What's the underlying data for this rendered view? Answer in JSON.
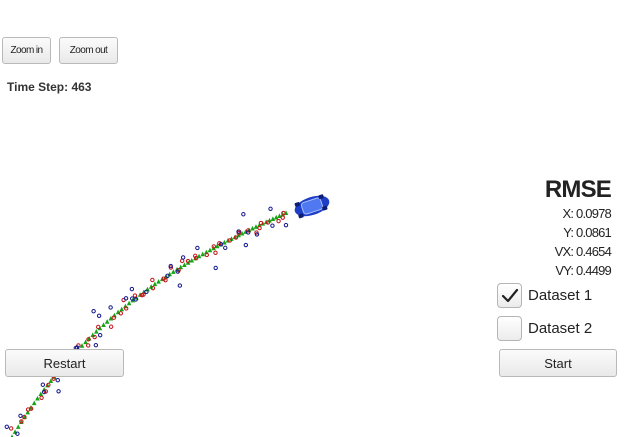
{
  "toolbar": {
    "zoom_in_label": "Zoom in",
    "zoom_out_label": "Zoom out"
  },
  "status": {
    "time_step_label": "Time Step: 463"
  },
  "rmse": {
    "title": "RMSE",
    "x": "X: 0.0978",
    "y": "Y: 0.0861",
    "vx": "VX: 0.4654",
    "vy": "VY: 0.4499"
  },
  "datasets": [
    {
      "label": "Dataset 1",
      "checked": true
    },
    {
      "label": "Dataset 2",
      "checked": false
    }
  ],
  "controls": {
    "restart_label": "Restart",
    "start_label": "Start"
  },
  "colors": {
    "estimate": "#16a316",
    "lidar": "#c5161b",
    "radar": "#151a8f",
    "car": "#1d3ec6",
    "checkmark": "#222222"
  },
  "icons": {
    "car": "car-icon",
    "checkmark": "checkmark-icon"
  }
}
